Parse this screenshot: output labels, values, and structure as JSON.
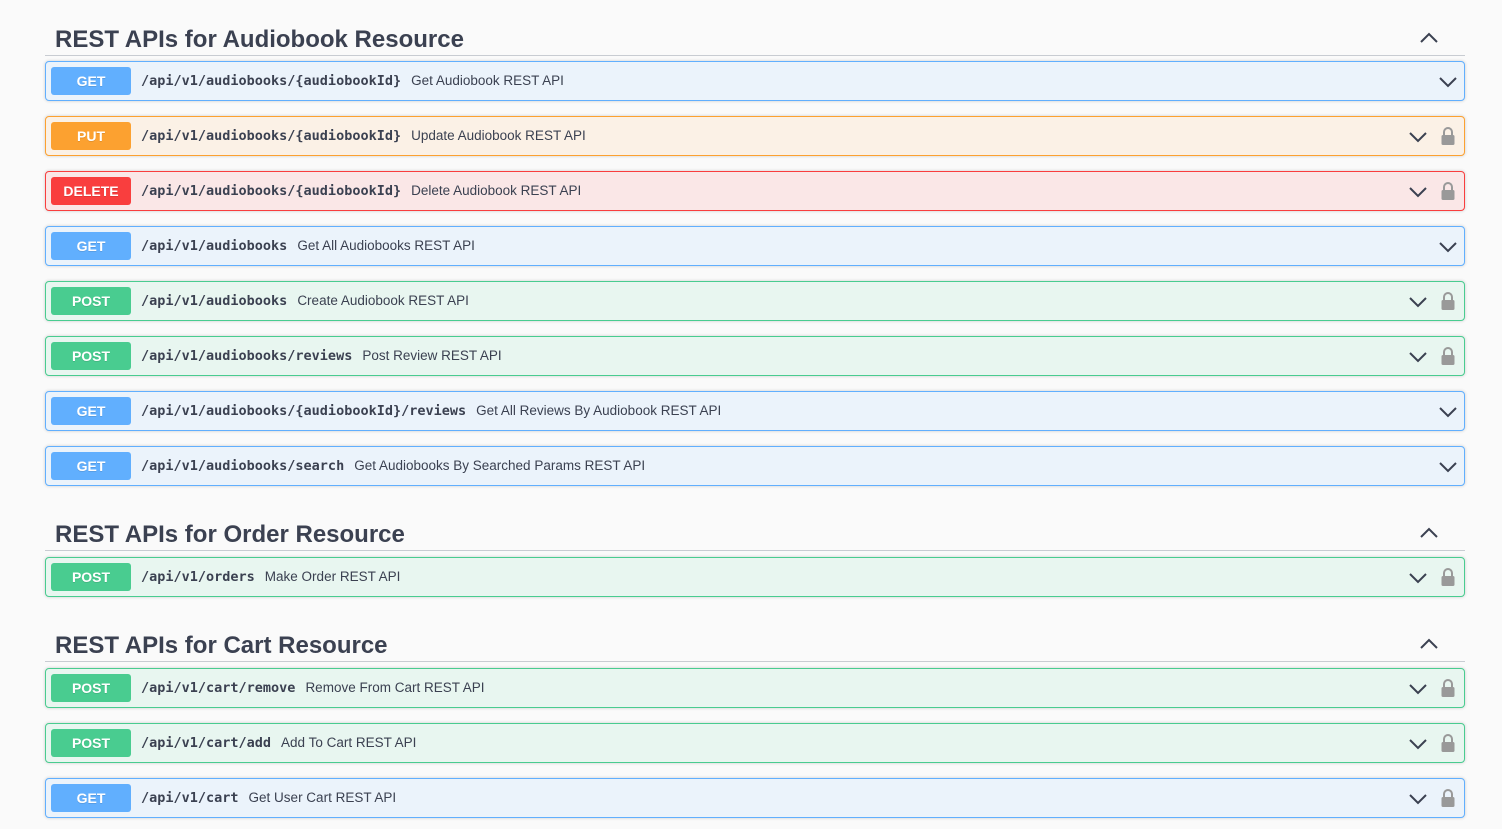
{
  "sections": [
    {
      "title": "REST APIs for Audiobook Resource",
      "operations": [
        {
          "method": "GET",
          "path": "/api/v1/audiobooks/{audiobookId}",
          "summary": "Get Audiobook REST API",
          "locked": false
        },
        {
          "method": "PUT",
          "path": "/api/v1/audiobooks/{audiobookId}",
          "summary": "Update Audiobook REST API",
          "locked": true
        },
        {
          "method": "DELETE",
          "path": "/api/v1/audiobooks/{audiobookId}",
          "summary": "Delete Audiobook REST API",
          "locked": true
        },
        {
          "method": "GET",
          "path": "/api/v1/audiobooks",
          "summary": "Get All Audiobooks REST API",
          "locked": false
        },
        {
          "method": "POST",
          "path": "/api/v1/audiobooks",
          "summary": "Create Audiobook REST API",
          "locked": true
        },
        {
          "method": "POST",
          "path": "/api/v1/audiobooks/reviews",
          "summary": "Post Review REST API",
          "locked": true
        },
        {
          "method": "GET",
          "path": "/api/v1/audiobooks/{audiobookId}/reviews",
          "summary": "Get All Reviews By Audiobook REST API",
          "locked": false
        },
        {
          "method": "GET",
          "path": "/api/v1/audiobooks/search",
          "summary": "Get Audiobooks By Searched Params REST API",
          "locked": false
        }
      ]
    },
    {
      "title": "REST APIs for Order Resource",
      "operations": [
        {
          "method": "POST",
          "path": "/api/v1/orders",
          "summary": "Make Order REST API",
          "locked": true
        }
      ]
    },
    {
      "title": "REST APIs for Cart Resource",
      "operations": [
        {
          "method": "POST",
          "path": "/api/v1/cart/remove",
          "summary": "Remove From Cart REST API",
          "locked": true
        },
        {
          "method": "POST",
          "path": "/api/v1/cart/add",
          "summary": "Add To Cart REST API",
          "locked": true
        },
        {
          "method": "GET",
          "path": "/api/v1/cart",
          "summary": "Get User Cart REST API",
          "locked": true
        }
      ]
    }
  ],
  "icons": {
    "collapse": "chevron-up-icon",
    "expand": "chevron-down-icon",
    "lock": "lock-icon"
  },
  "colors": {
    "get": "#61affe",
    "put": "#fca130",
    "delete": "#f93e3e",
    "post": "#49cc90"
  }
}
